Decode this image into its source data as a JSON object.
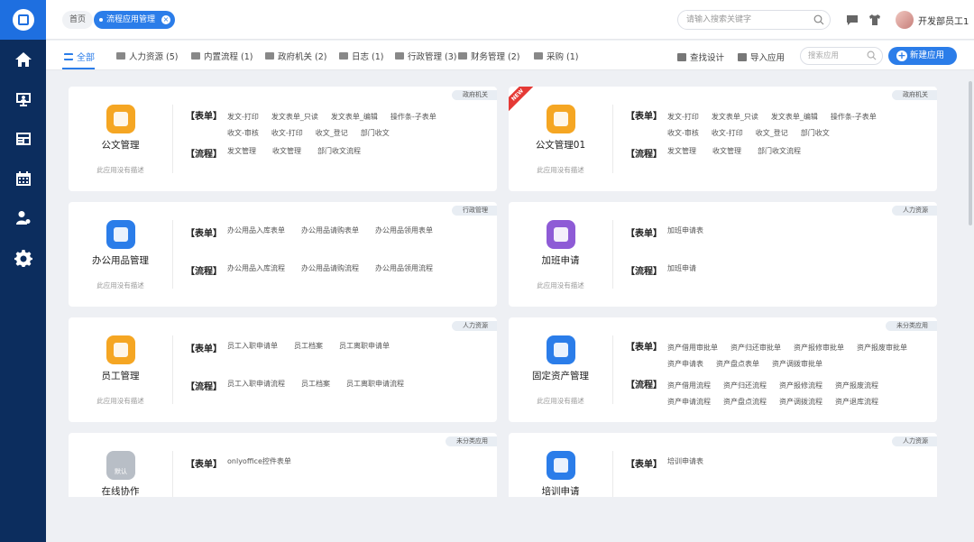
{
  "header": {
    "home_crumb": "首页",
    "active_tab": "流程应用管理",
    "search_placeholder": "请输入搜索关键字",
    "username": "开发部员工1"
  },
  "filters": {
    "tabs": [
      {
        "label": "全部"
      },
      {
        "label": "人力资源 (5)"
      },
      {
        "label": "内置流程 (1)"
      },
      {
        "label": "政府机关 (2)"
      },
      {
        "label": "日志 (1)"
      },
      {
        "label": "行政管理 (3)"
      },
      {
        "label": "财务管理 (2)"
      },
      {
        "label": "采购 (1)"
      }
    ],
    "find_design": "查找设计",
    "import_app": "导入应用",
    "search_placeholder": "搜索应用",
    "new_app": "新建应用"
  },
  "cards": [
    {
      "name": "公文管理",
      "desc": "此应用没有描述",
      "tag": "政府机关",
      "icon_color": "#f5a623",
      "form_label": "【表单】",
      "forms": [
        "发文-打印",
        "发文表单_只读",
        "发文表单_编辑",
        "操作条-子表单",
        "收文-审核",
        "收文-打印",
        "收文_登记",
        "部门收文"
      ],
      "flow_label": "【流程】",
      "flows": [
        "发文管理",
        "收文管理",
        "部门收文流程"
      ]
    },
    {
      "name": "公文管理01",
      "desc": "此应用没有描述",
      "tag": "政府机关",
      "icon_color": "#f5a623",
      "ribbon": "NEW",
      "form_label": "【表单】",
      "forms": [
        "发文-打印",
        "发文表单_只读",
        "发文表单_编辑",
        "操作条-子表单",
        "收文-审核",
        "收文-打印",
        "收文_登记",
        "部门收文"
      ],
      "flow_label": "【流程】",
      "flows": [
        "发文管理",
        "收文管理",
        "部门收文流程"
      ]
    },
    {
      "name": "办公用品管理",
      "desc": "此应用没有描述",
      "tag": "行政管理",
      "icon_color": "#2b7de9",
      "form_label": "【表单】",
      "forms": [
        "办公用品入库表单",
        "办公用品请购表单",
        "办公用品领用表单"
      ],
      "flow_label": "【流程】",
      "flows": [
        "办公用品入库流程",
        "办公用品请购流程",
        "办公用品领用流程"
      ]
    },
    {
      "name": "加班申请",
      "desc": "此应用没有描述",
      "tag": "人力资源",
      "icon_color": "#8e5bd6",
      "form_label": "【表单】",
      "forms": [
        "加班申请表"
      ],
      "flow_label": "【流程】",
      "flows": [
        "加班申请"
      ]
    },
    {
      "name": "员工管理",
      "desc": "此应用没有描述",
      "tag": "人力资源",
      "icon_color": "#f5a623",
      "form_label": "【表单】",
      "forms": [
        "员工入职申请单",
        "员工档案",
        "员工离职申请单"
      ],
      "flow_label": "【流程】",
      "flows": [
        "员工入职申请流程",
        "员工档案",
        "员工离职申请流程"
      ]
    },
    {
      "name": "固定资产管理",
      "desc": "此应用没有描述",
      "tag": "未分类应用",
      "icon_color": "#2b7de9",
      "form_label": "【表单】",
      "forms": [
        "资产借用审批单",
        "资产归还审批单",
        "资产报修审批单",
        "资产报废审批单",
        "资产申请表",
        "资产盘点表单",
        "资产调拨审批单"
      ],
      "flow_label": "【流程】",
      "flows": [
        "资产借用流程",
        "资产归还流程",
        "资产报修流程",
        "资产报废流程",
        "资产申请流程",
        "资产盘点流程",
        "资产调拨流程",
        "资产退库流程"
      ]
    },
    {
      "name": "在线协作",
      "desc": "",
      "tag": "未分类应用",
      "icon_color": "#b8bec6",
      "icon_text": "默认",
      "form_label": "【表单】",
      "forms": [
        "onlyoffice控件表单"
      ],
      "flow_label": "",
      "flows": []
    },
    {
      "name": "培训申请",
      "desc": "",
      "tag": "人力资源",
      "icon_color": "#2b7de9",
      "form_label": "【表单】",
      "forms": [
        "培训申请表"
      ],
      "flow_label": "",
      "flows": []
    }
  ],
  "colors": {
    "accent": "#2b7de9",
    "sidebar": "#0c2d5e",
    "logo_bg": "#1e6fe0"
  }
}
